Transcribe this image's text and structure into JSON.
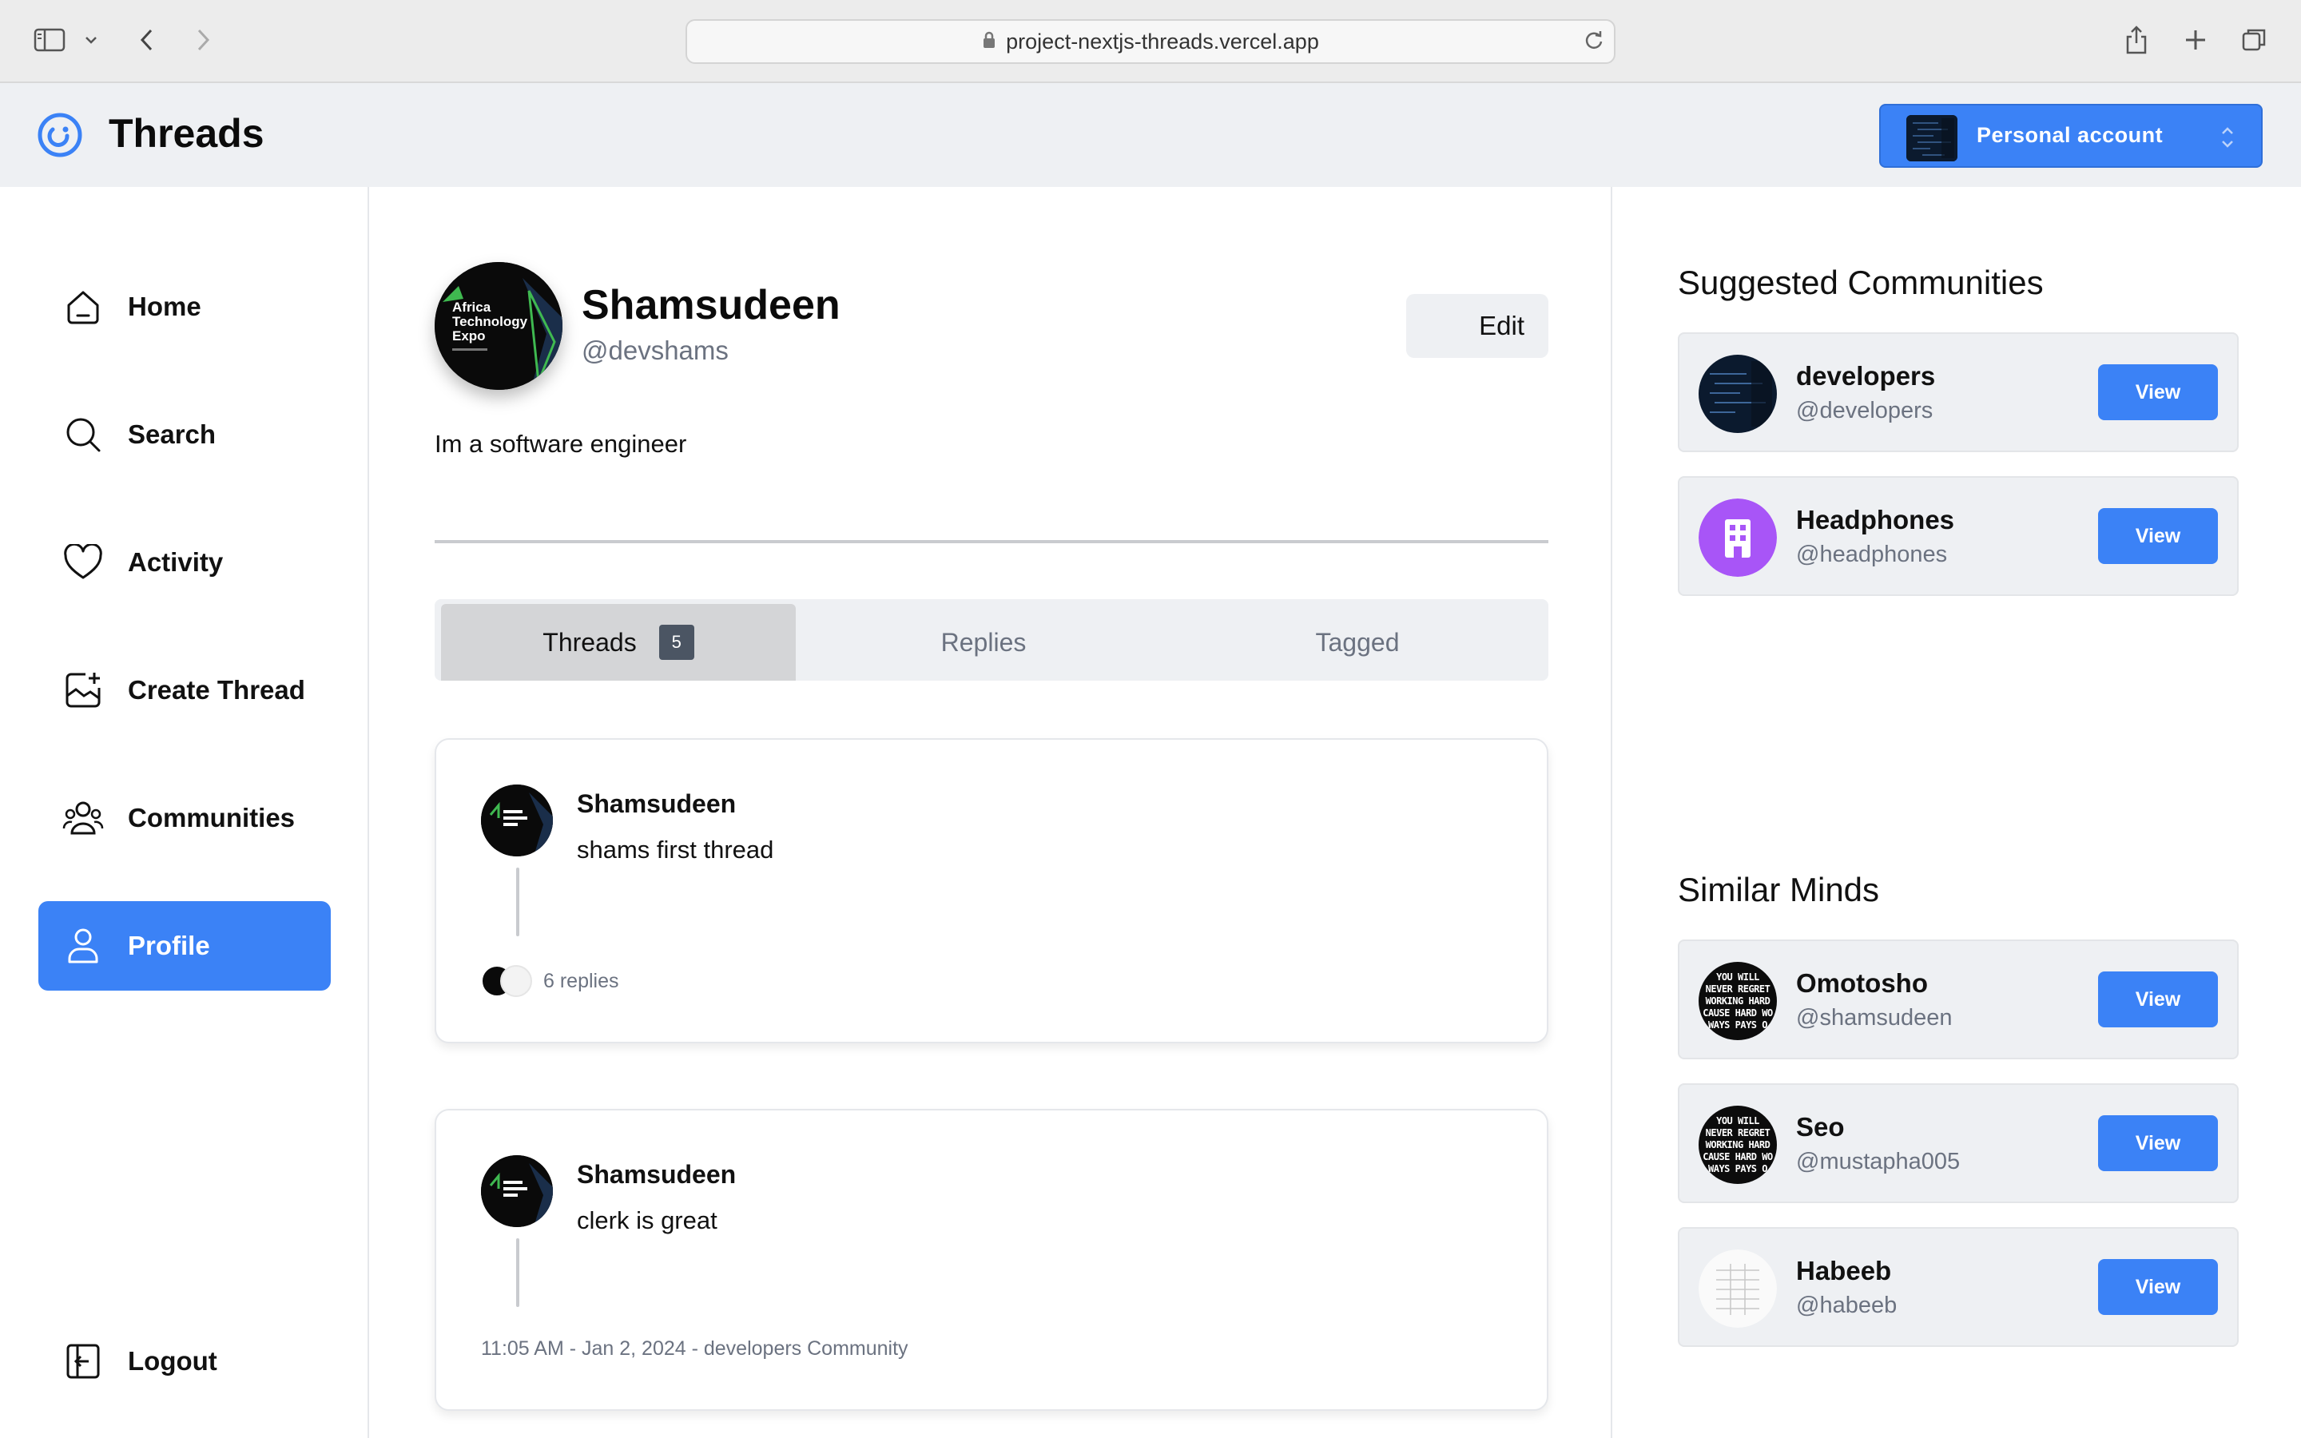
{
  "browser": {
    "url": "project-nextjs-threads.vercel.app"
  },
  "app": {
    "title": "Threads",
    "account_label": "Personal account"
  },
  "sidebar": {
    "items": [
      {
        "label": "Home",
        "icon": "home-icon"
      },
      {
        "label": "Search",
        "icon": "search-icon"
      },
      {
        "label": "Activity",
        "icon": "heart-icon"
      },
      {
        "label": "Create Thread",
        "icon": "create-thread-icon"
      },
      {
        "label": "Communities",
        "icon": "communities-icon"
      },
      {
        "label": "Profile",
        "icon": "user-icon",
        "active": true
      }
    ],
    "logout_label": "Logout"
  },
  "profile": {
    "name": "Shamsudeen",
    "handle": "@devshams",
    "bio": "Im a software engineer",
    "edit_label": "Edit",
    "avatar_text": [
      "Africa",
      "Technology",
      "Expo"
    ]
  },
  "tabs": [
    {
      "label": "Threads",
      "count": "5",
      "active": true
    },
    {
      "label": "Replies"
    },
    {
      "label": "Tagged"
    }
  ],
  "threads": [
    {
      "author": "Shamsudeen",
      "text": "shams first thread",
      "replies": "6 replies"
    },
    {
      "author": "Shamsudeen",
      "text": "clerk is great",
      "meta": "11:05 AM - Jan 2, 2024 - developers Community"
    }
  ],
  "suggested_communities": {
    "title": "Suggested Communities",
    "items": [
      {
        "name": "developers",
        "handle": "@developers",
        "action": "View"
      },
      {
        "name": "Headphones",
        "handle": "@headphones",
        "action": "View"
      }
    ]
  },
  "similar_minds": {
    "title": "Similar Minds",
    "items": [
      {
        "name": "Omotosho",
        "handle": "@shamsudeen",
        "action": "View"
      },
      {
        "name": "Seo",
        "handle": "@mustapha005",
        "action": "View"
      },
      {
        "name": "Habeeb",
        "handle": "@habeeb",
        "action": "View"
      }
    ]
  },
  "avatar_motivation_text": [
    "YOU WILL",
    "NEVER REGRET",
    "WORKING HARD",
    "CAUSE HARD WO",
    "WAYS PAYS O"
  ],
  "colors": {
    "accent": "#3b82f6",
    "muted_text": "#6b7280",
    "panel_bg": "#eef0f3"
  }
}
